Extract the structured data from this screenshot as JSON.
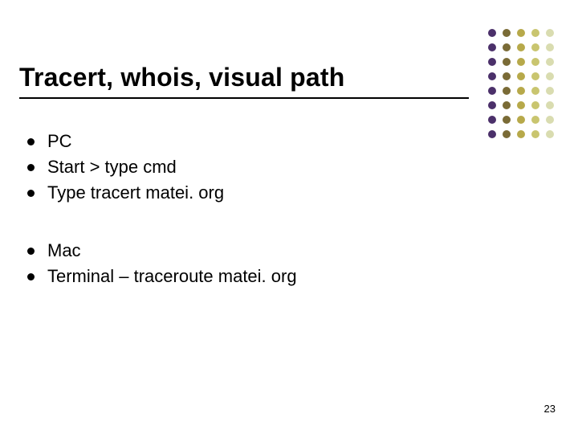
{
  "title": "Tracert, whois, visual path",
  "groups": [
    {
      "items": [
        "PC",
        "Start > type cmd",
        "Type tracert matei. org"
      ]
    },
    {
      "items": [
        "Mac",
        "Terminal – traceroute matei. org"
      ]
    }
  ],
  "page_number": "23",
  "decor": {
    "columns": 5,
    "rows": 8,
    "column_colors": [
      "#4b306a",
      "#7a6b36",
      "#b7a94a",
      "#c9c56f",
      "#d9dcb0"
    ]
  }
}
